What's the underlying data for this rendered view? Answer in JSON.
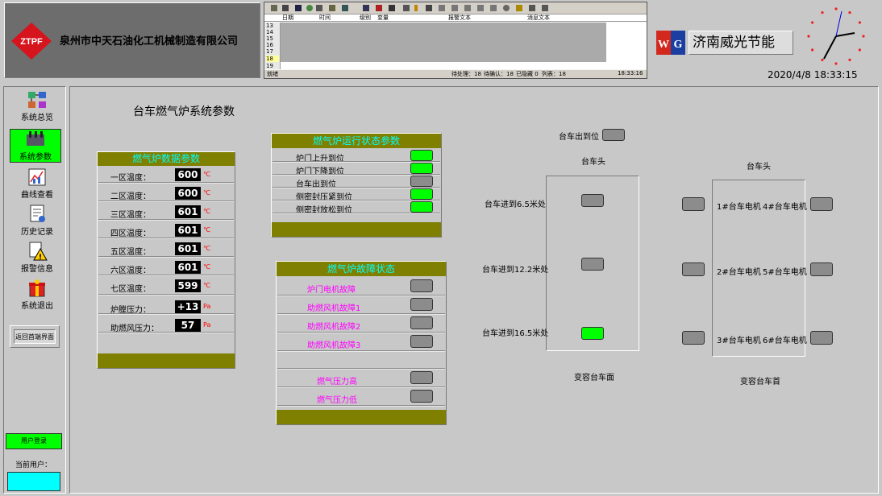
{
  "header": {
    "company_logo": "ZTPF",
    "company_name": "泉州市中天石油化工机械制造有限公司",
    "partner_name": "济南威光节能",
    "datetime": "2020/4/8 18:33:15"
  },
  "alarm_grid": {
    "columns": [
      "日期",
      "时间",
      "级别",
      "变量",
      "报警文本",
      "消息文本"
    ],
    "row_numbers": [
      "13",
      "14",
      "15",
      "16",
      "17",
      "18",
      "19"
    ],
    "status_text": "就绪",
    "counts": {
      "pending": "待处理：18",
      "confirmed": "待确认：18",
      "hidden": "已隐藏 0",
      "list": "列表：18"
    },
    "time": "18:33:16"
  },
  "sidebar": {
    "items": [
      {
        "label": "系统总览"
      },
      {
        "label": "系统参数"
      },
      {
        "label": "曲线查看"
      },
      {
        "label": "历史记录"
      },
      {
        "label": "报警信息"
      },
      {
        "label": "系统退出"
      }
    ],
    "back_button": "返回首端界面",
    "login_button": "用户登录",
    "current_user_label": "当前用户："
  },
  "main": {
    "title": "台车燃气炉系统参数"
  },
  "data_panel": {
    "title": "燃气炉数据参数",
    "rows": [
      {
        "label": "一区温度：",
        "value": "600",
        "unit": "℃"
      },
      {
        "label": "二区温度：",
        "value": "600",
        "unit": "℃"
      },
      {
        "label": "三区温度：",
        "value": "601",
        "unit": "℃"
      },
      {
        "label": "四区温度：",
        "value": "601",
        "unit": "℃"
      },
      {
        "label": "五区温度：",
        "value": "601",
        "unit": "℃"
      },
      {
        "label": "六区温度：",
        "value": "601",
        "unit": "℃"
      },
      {
        "label": "七区温度：",
        "value": "599",
        "unit": "℃"
      },
      {
        "label": "炉膛压力：",
        "value": "+13",
        "unit": "Pa"
      },
      {
        "label": "助燃风压力：",
        "value": "57",
        "unit": "Pa"
      }
    ]
  },
  "status_panel": {
    "title": "燃气炉运行状态参数",
    "rows": [
      {
        "label": "炉门上升到位",
        "on": true
      },
      {
        "label": "炉门下降到位",
        "on": true
      },
      {
        "label": "台车出到位",
        "on": false
      },
      {
        "label": "侧密封压紧到位",
        "on": true
      },
      {
        "label": "侧密封放松到位",
        "on": true
      }
    ]
  },
  "fault_panel": {
    "title": "燃气炉故障状态",
    "rows": [
      {
        "label": "炉门电机故障",
        "on": false
      },
      {
        "label": "助燃风机故障1",
        "on": false
      },
      {
        "label": "助燃风机故障2",
        "on": false
      },
      {
        "label": "助燃风机故障3",
        "on": false
      },
      {
        "label": "燃气压力高",
        "on": false
      },
      {
        "label": "燃气压力低",
        "on": false
      }
    ]
  },
  "cart_left": {
    "exit_label": "台车出到位",
    "head_label": "台车头",
    "floor_label": "变容台车面",
    "positions": [
      {
        "label": "台车进到6.5米处",
        "on": false
      },
      {
        "label": "台车进到12.2米处",
        "on": false
      },
      {
        "label": "台车进到16.5米处",
        "on": true
      }
    ]
  },
  "cart_right": {
    "head_label": "台车头",
    "floor_label": "变容台车首",
    "motors": [
      {
        "left": "1#台车电机",
        "right": "4#台车电机"
      },
      {
        "left": "2#台车电机",
        "right": "5#台车电机"
      },
      {
        "left": "3#台车电机",
        "right": "6#台车电机"
      }
    ]
  },
  "colors": {
    "on": "#00ff00",
    "off": "#8c8c8c",
    "olive": "#7f7f00",
    "fault_text": "#ff00ff",
    "title_text": "#00ffff"
  }
}
